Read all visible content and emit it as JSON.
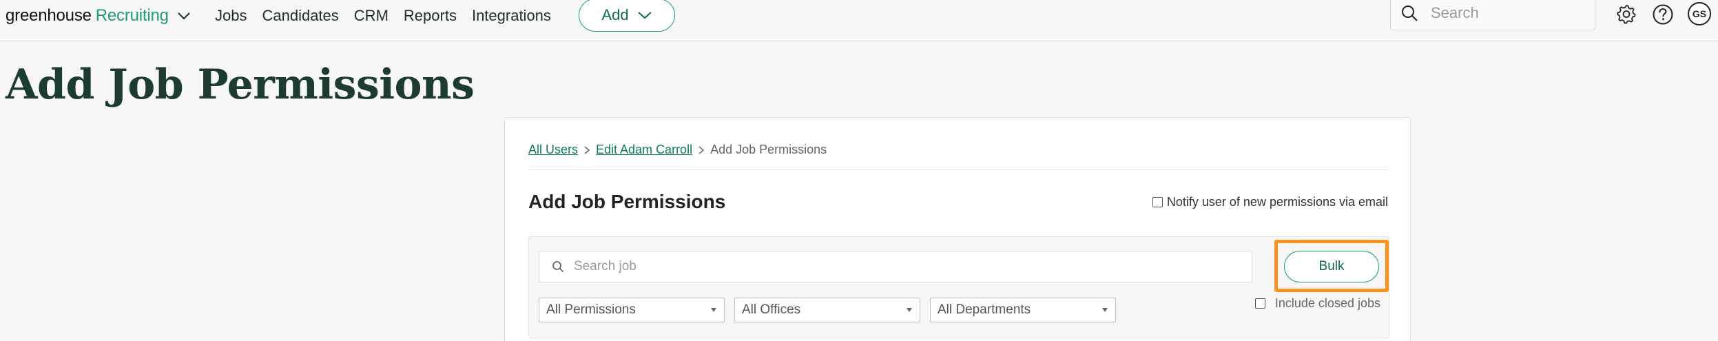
{
  "nav": {
    "brand_primary": "greenhouse",
    "brand_secondary": "Recruiting",
    "links": [
      "Jobs",
      "Candidates",
      "CRM",
      "Reports",
      "Integrations"
    ],
    "add_label": "Add",
    "search_placeholder": "Search",
    "avatar_initials": "GS",
    "icons": [
      "chevron-down-icon",
      "search-icon",
      "gear-icon",
      "help-icon"
    ]
  },
  "page": {
    "title": "Add Job Permissions"
  },
  "breadcrumb": {
    "items": [
      "All Users",
      "Edit Adam Carroll"
    ],
    "current": "Add Job Permissions"
  },
  "card": {
    "title": "Add Job Permissions",
    "notify_label": "Notify user of new permissions via email",
    "notify_checked": false
  },
  "filters": {
    "search_placeholder": "Search job",
    "bulk_label": "Bulk",
    "permissions_selected": "All Permissions",
    "offices_selected": "All Offices",
    "departments_selected": "All Departments",
    "include_closed_label": "Include closed jobs",
    "include_closed_checked": false
  },
  "colors": {
    "accent_green": "#1f9c72",
    "link_green": "#0f7b5a",
    "title_dark_green": "#1d3b33",
    "highlight_orange": "#f7931e"
  }
}
